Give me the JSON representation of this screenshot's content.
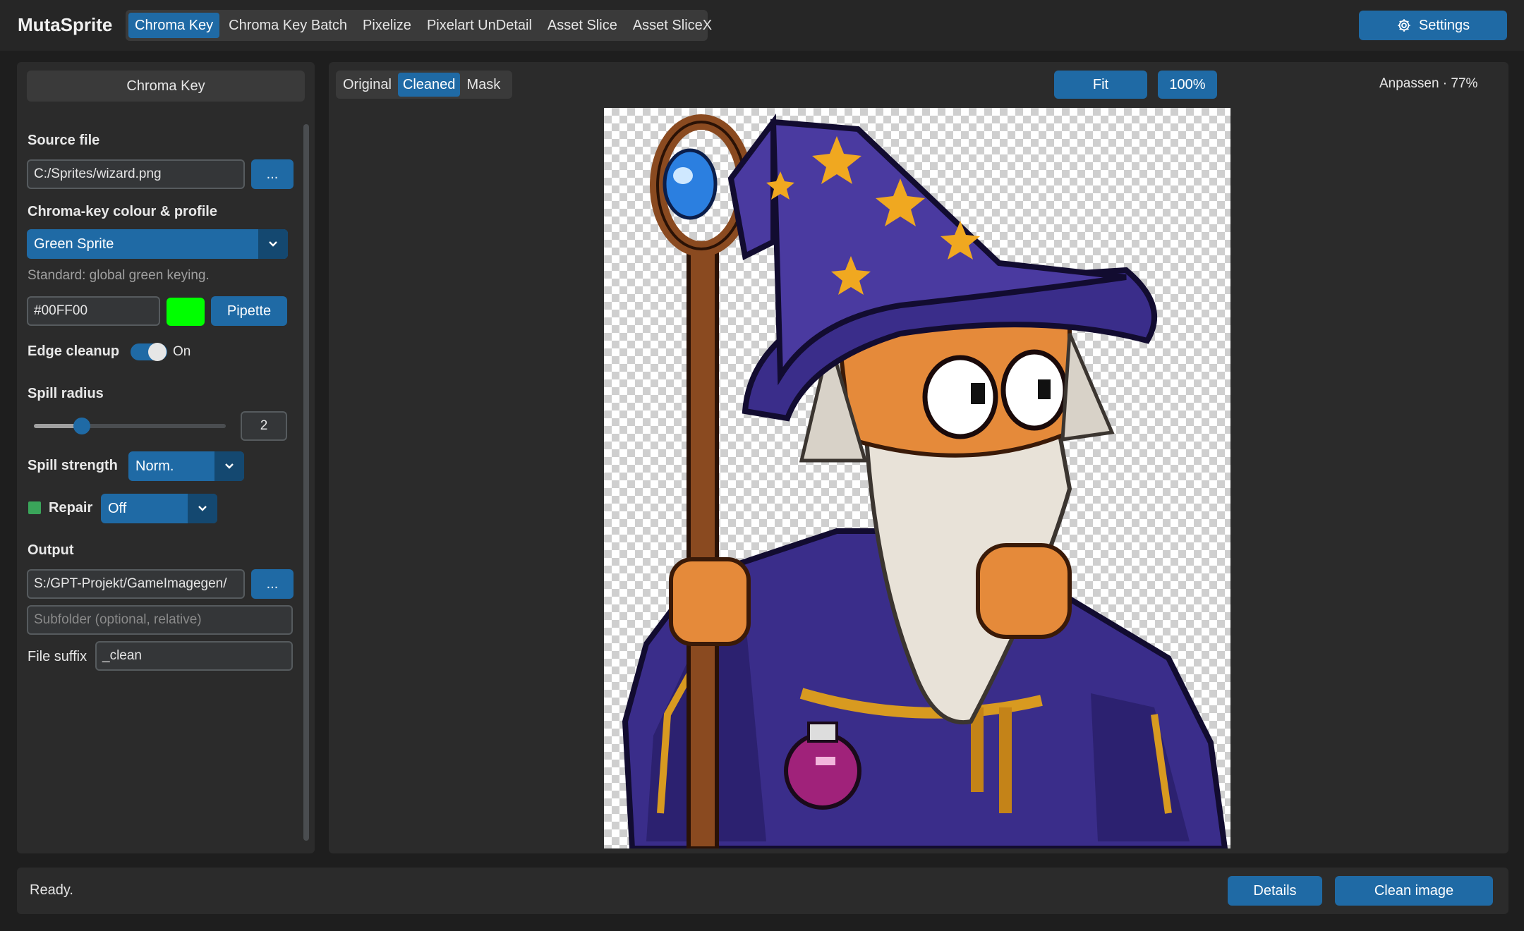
{
  "app": {
    "title": "MutaSprite"
  },
  "tabs": [
    {
      "label": "Chroma Key",
      "active": true
    },
    {
      "label": "Chroma Key Batch",
      "active": false
    },
    {
      "label": "Pixelize",
      "active": false
    },
    {
      "label": "Pixelart UnDetail",
      "active": false
    },
    {
      "label": "Asset Slice",
      "active": false
    },
    {
      "label": "Asset SliceX",
      "active": false
    }
  ],
  "settings": {
    "label": "Settings",
    "icon": "gear-icon"
  },
  "panel": {
    "header": "Chroma Key",
    "source": {
      "label": "Source file",
      "value": "C:/Sprites/wizard.png",
      "browse_label": "..."
    },
    "chroma": {
      "label": "Chroma-key colour & profile",
      "profile": "Green Sprite",
      "hint": "Standard: global green keying.",
      "hex": "#00FF00",
      "swatch_color": "#00FF00",
      "pipette_label": "Pipette"
    },
    "edge": {
      "label": "Edge cleanup",
      "state": "On"
    },
    "spill_radius": {
      "label": "Spill radius",
      "value": "2",
      "fraction": 0.25
    },
    "spill_strength": {
      "label": "Spill strength",
      "value": "Norm."
    },
    "repair": {
      "label": "Repair",
      "value": "Off"
    },
    "output": {
      "label": "Output",
      "path": "S:/GPT-Projekt/GameImagegen/",
      "browse_label": "...",
      "subfolder_placeholder": "Subfolder (optional, relative)",
      "suffix_label": "File suffix",
      "suffix_value": "_clean"
    }
  },
  "preview": {
    "views": [
      {
        "label": "Original",
        "active": false
      },
      {
        "label": "Cleaned",
        "active": true
      },
      {
        "label": "Mask",
        "active": false
      }
    ],
    "fit_label": "Fit",
    "zoom100_label": "100%",
    "zoom_info": "Anpassen · 77%"
  },
  "status": {
    "text": "Ready.",
    "details_label": "Details",
    "clean_label": "Clean image"
  },
  "colors": {
    "accent": "#1f6aa5",
    "accent_dark": "#144870",
    "repair_check": "#3aa55a"
  }
}
